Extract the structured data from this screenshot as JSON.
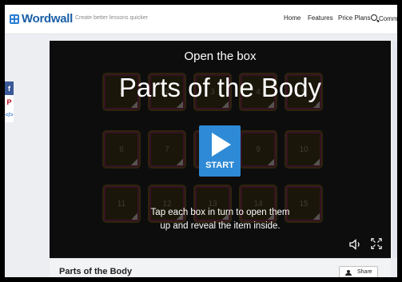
{
  "header": {
    "logo": "Wordwall",
    "tagline": "Create better lessons quicker",
    "nav": [
      "Home",
      "Features",
      "Price Plans",
      "Commun"
    ]
  },
  "social": [
    {
      "label": "f",
      "color": "#3b5998"
    },
    {
      "label": "P",
      "color": "#bd081c"
    },
    {
      "label": "</>",
      "color": "#3a7bd5"
    }
  ],
  "game": {
    "instruction": "Open the box",
    "title": "Parts of the Body",
    "start_label": "START",
    "hint_line1": "Tap each box in turn to open them",
    "hint_line2": "up and reveal the item inside.",
    "tiles": [
      "1",
      "2",
      "3",
      "4",
      "5",
      "6",
      "7",
      "8",
      "9",
      "10",
      "11",
      "12",
      "13",
      "14",
      "15"
    ]
  },
  "footer": {
    "title": "Parts of the Body",
    "share_label": "Share"
  },
  "colors": {
    "accent": "#2e8ad6",
    "brand": "#1a5fa8"
  }
}
